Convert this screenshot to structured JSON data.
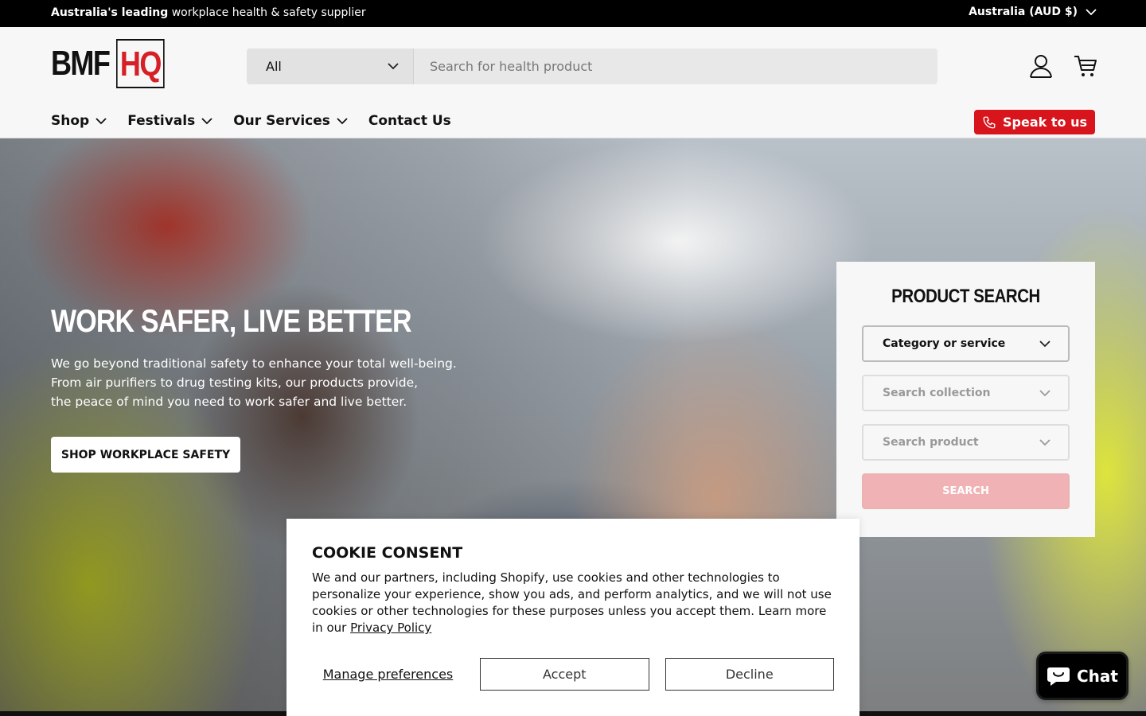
{
  "announcement": {
    "bold": "Australia's leading",
    "rest": " workplace health & safety supplier",
    "currency": "Australia (AUD $)"
  },
  "header": {
    "logo_left": "BMF",
    "logo_right": "HQ",
    "search_category": "All",
    "search_placeholder": "Search for health product",
    "account_icon": "account-icon",
    "cart_icon": "cart-icon"
  },
  "nav": {
    "items": [
      {
        "label": "Shop",
        "dropdown": true
      },
      {
        "label": "Festivals",
        "dropdown": true
      },
      {
        "label": "Our Services",
        "dropdown": true
      },
      {
        "label": "Contact Us",
        "dropdown": false
      }
    ],
    "speak_label": "Speak to us"
  },
  "hero": {
    "title": "WORK SAFER, LIVE BETTER",
    "subtitle_lines": [
      "We go beyond traditional safety to enhance your total well-being.",
      "From air purifiers to drug testing kits, our products provide,",
      "the peace of mind you need to work safer and live better."
    ],
    "cta": "SHOP WORKPLACE SAFETY"
  },
  "product_search": {
    "title": "PRODUCT SEARCH",
    "category": "Category or service",
    "collection": "Search collection",
    "product": "Search product",
    "button": "SEARCH"
  },
  "cookie": {
    "title": "COOKIE CONSENT",
    "body": "We and our partners, including Shopify, use cookies and other technologies to personalize your experience, show you ads, and perform analytics, and we will not use cookies or other technologies for these purposes unless you accept them. Learn more in our ",
    "link": "Privacy Policy",
    "manage": "Manage preferences",
    "accept": "Accept",
    "decline": "Decline"
  },
  "chat": {
    "label": "Chat"
  },
  "colors": {
    "accent": "#d8141c",
    "announcement_bg": "#000000",
    "search_button_disabled": "#f0b2b5"
  }
}
